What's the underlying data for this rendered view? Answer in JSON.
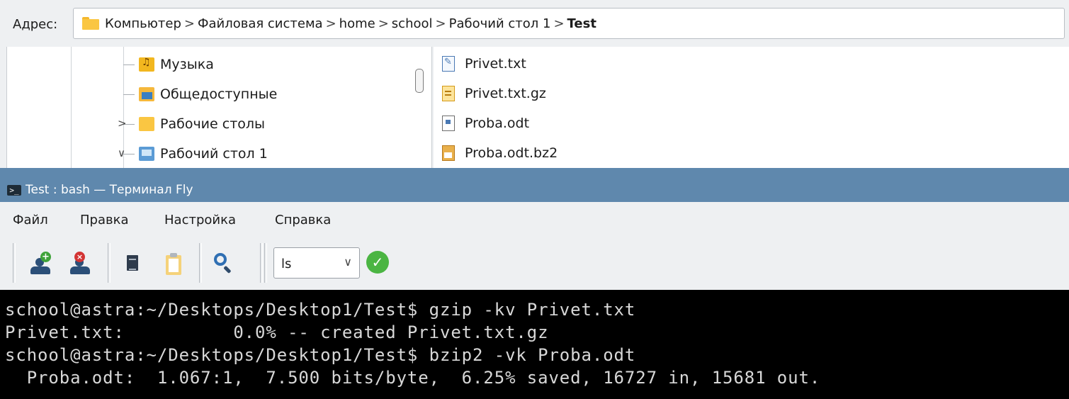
{
  "file_manager": {
    "address_label": "Адрес:",
    "breadcrumb": [
      "Компьютер",
      "Файловая система",
      "home",
      "school",
      "Рабочий стол 1",
      "Test"
    ],
    "separator": ">",
    "tree_items": [
      {
        "label": "Музыка",
        "icon": "music-folder-icon"
      },
      {
        "label": "Общедоступные",
        "icon": "public-folder-icon"
      },
      {
        "label": "Рабочие столы",
        "icon": "folder-icon",
        "expander": ">"
      },
      {
        "label": "Рабочий стол 1",
        "icon": "desktop-folder-icon",
        "expander": "∨"
      }
    ],
    "files": [
      {
        "name": "Privet.txt",
        "icon": "text-file-icon"
      },
      {
        "name": "Privet.txt.gz",
        "icon": "gzip-archive-icon"
      },
      {
        "name": "Proba.odt",
        "icon": "odt-document-icon"
      },
      {
        "name": "Proba.odt.bz2",
        "icon": "bzip2-archive-icon"
      }
    ]
  },
  "terminal": {
    "window_title": "Test : bash — Терминал Fly",
    "title_icon_glyph": ">_",
    "menu": [
      "Файл",
      "Правка",
      "Настройка",
      "Справка"
    ],
    "toolbar": {
      "command_select_value": "ls",
      "chevron": "∨",
      "run_glyph": "✓",
      "add_badge": "+",
      "del_badge": "×"
    },
    "output_lines": [
      "school@astra:~/Desktops/Desktop1/Test$ gzip -kv Privet.txt",
      "Privet.txt:          0.0% -- created Privet.txt.gz",
      "school@astra:~/Desktops/Desktop1/Test$ bzip2 -vk Proba.odt",
      "  Proba.odt:  1.067:1,  7.500 bits/byte,  6.25% saved, 16727 in, 15681 out."
    ]
  },
  "colors": {
    "titlebar": "#5f88ad",
    "terminal_bg": "#000000",
    "terminal_fg": "#d8d8d8",
    "window_bg": "#eef0f2"
  }
}
